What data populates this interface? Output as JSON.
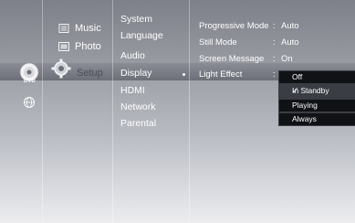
{
  "left_nav": {
    "disc_label": "DVD"
  },
  "main_menu": {
    "items": [
      {
        "label": "Music"
      },
      {
        "label": "Photo"
      },
      {
        "label": "Setup"
      }
    ]
  },
  "sub_menu": {
    "items": [
      {
        "label": "System"
      },
      {
        "label": "Language"
      },
      {
        "label": "Audio"
      },
      {
        "label": "Display"
      },
      {
        "label": "HDMI"
      },
      {
        "label": "Network"
      },
      {
        "label": "Parental"
      }
    ]
  },
  "options": [
    {
      "label": "Progressive Mode",
      "colon": ":",
      "value": "Auto"
    },
    {
      "label": "Still Mode",
      "colon": ":",
      "value": "Auto"
    },
    {
      "label": "Screen Message",
      "colon": ":",
      "value": "On"
    },
    {
      "label": "Light Effect",
      "colon": ":",
      "value": ""
    }
  ],
  "popup": {
    "items": [
      {
        "label": "Off"
      },
      {
        "label": "In Standby",
        "check": "✓"
      },
      {
        "label": "Playing"
      },
      {
        "label": "Always"
      }
    ]
  }
}
